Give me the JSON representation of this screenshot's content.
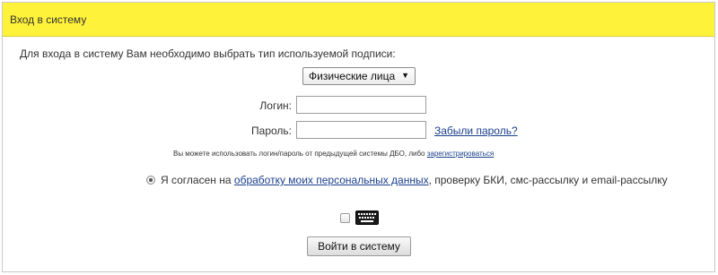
{
  "header": {
    "title": "Вход в систему"
  },
  "form": {
    "intro": "Для входа в систему Вам необходимо выбрать тип используемой подписи:",
    "signature_type": {
      "selected": "Физические лица"
    },
    "login_label": "Логин:",
    "login_value": "",
    "password_label": "Пароль:",
    "password_value": "",
    "forgot_link": "Забыли пароль?",
    "note_text": "Вы можете использовать логин/пароль от предыдущей системы ДБО, либо",
    "register_link": "зарегистрироваться",
    "consent": {
      "prefix": "Я согласен на",
      "link": "обработку моих персональных данных",
      "suffix": ", проверку БКИ, смс-рассылку и email-рассылку",
      "checked": true
    },
    "virtual_keyboard": {
      "checked": false,
      "icon": "keyboard-icon"
    },
    "submit_label": "Войти в систему"
  },
  "colors": {
    "header_bg": "#fff23a",
    "link": "#1a3f8c"
  }
}
